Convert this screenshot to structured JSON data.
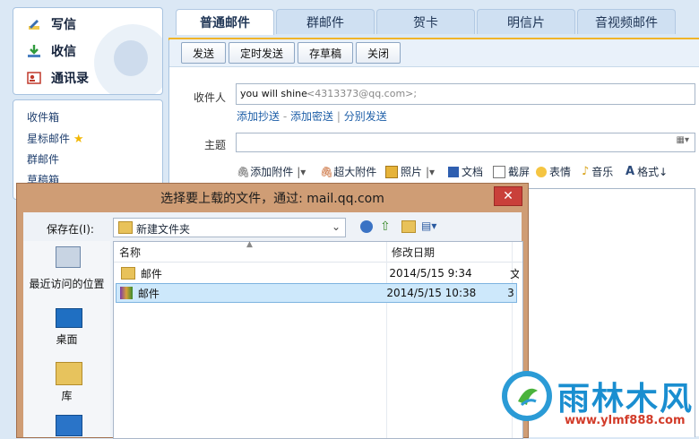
{
  "sidebar": {
    "compose": "写信",
    "inbox": "收信",
    "contacts": "通讯录",
    "folders": [
      "收件箱",
      "星标邮件",
      "群邮件",
      "草稿箱"
    ]
  },
  "tabs": [
    "普通邮件",
    "群邮件",
    "贺卡",
    "明信片",
    "音视频邮件"
  ],
  "toolbar": {
    "send": "发送",
    "timed": "定时发送",
    "draft": "存草稿",
    "close": "关闭"
  },
  "compose": {
    "to_label": "收件人",
    "to_name": "you will shine",
    "to_addr": "<4313373@qq.com>;",
    "add_cc": "添加抄送",
    "dash": "-",
    "add_bcc": "添加密送",
    "pipe": "|",
    "separate": "分别发送",
    "subject_label": "主题",
    "attach": [
      "添加附件",
      "超大附件",
      "照片",
      "文档",
      "截屏",
      "表情",
      "音乐",
      "格式"
    ]
  },
  "dialog": {
    "title": "选择要上载的文件，通过: mail.qq.com",
    "close": "✕",
    "save_in_label": "保存在(I):",
    "folder": "新建文件夹",
    "places": [
      "最近访问的位置",
      "桌面",
      "库"
    ],
    "columns": {
      "name": "名称",
      "date": "修改日期"
    },
    "files": [
      {
        "name": "邮件",
        "date": "2014/5/15 9:34",
        "extra": "文"
      },
      {
        "name": "邮件",
        "date": "2014/5/15 10:38",
        "extra": "3"
      }
    ]
  },
  "watermark": {
    "name": "雨林木风",
    "url": "www.ylmf888.com"
  },
  "colors": {
    "accent": "#f0b428",
    "close_red": "#c9403a",
    "link": "#1e5fa8"
  }
}
